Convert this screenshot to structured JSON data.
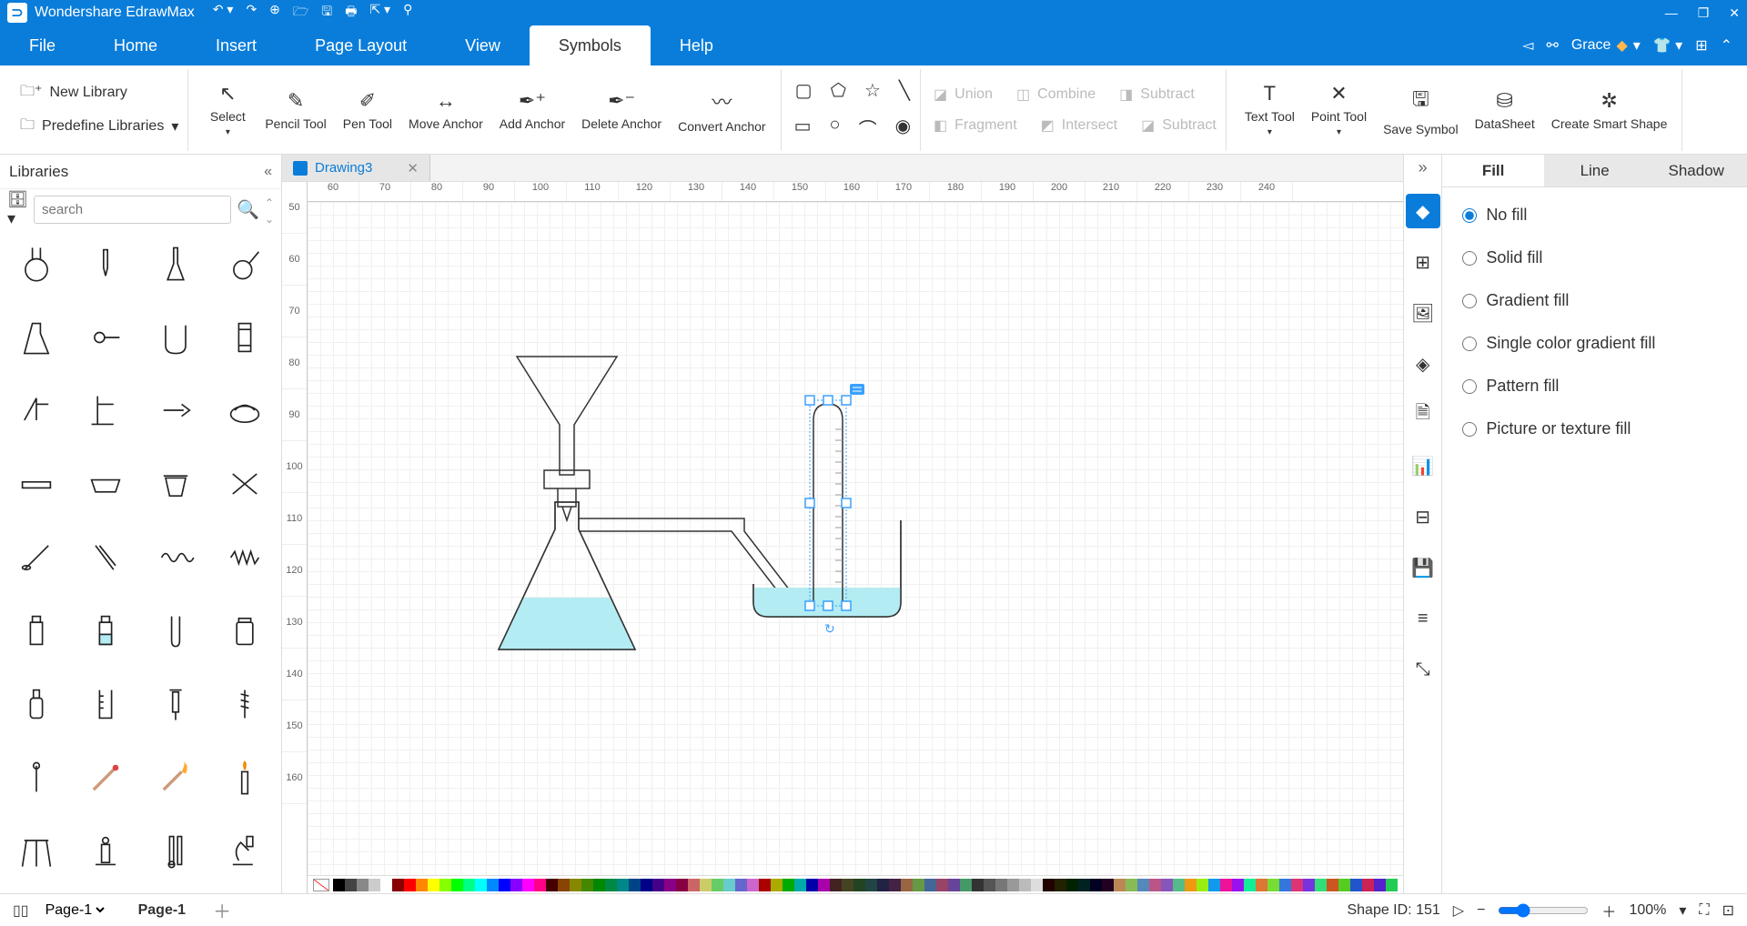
{
  "app": {
    "title": "Wondershare EdrawMax"
  },
  "menu": {
    "items": [
      "File",
      "Home",
      "Insert",
      "Page Layout",
      "View",
      "Symbols",
      "Help"
    ],
    "active": "Symbols",
    "user": "Grace"
  },
  "ribbon": {
    "new_library": "New Library",
    "predef_libs": "Predefine Libraries",
    "select": "Select",
    "pencil": "Pencil Tool",
    "pen": "Pen Tool",
    "move_anchor": "Move Anchor",
    "add_anchor": "Add Anchor",
    "delete_anchor": "Delete Anchor",
    "convert_anchor": "Convert Anchor",
    "bool": {
      "union": "Union",
      "combine": "Combine",
      "subtract": "Subtract",
      "fragment": "Fragment",
      "intersect": "Intersect",
      "subtract2": "Subtract"
    },
    "text_tool": "Text Tool",
    "point_tool": "Point Tool",
    "save_symbol": "Save Symbol",
    "datasheet": "DataSheet",
    "create_smart": "Create Smart Shape"
  },
  "left": {
    "header": "Libraries",
    "search_placeholder": "search"
  },
  "tab": {
    "name": "Drawing3"
  },
  "ruler_h": [
    "60",
    "70",
    "80",
    "90",
    "100",
    "110",
    "120",
    "130",
    "140",
    "150",
    "160",
    "170",
    "180",
    "190",
    "200",
    "210",
    "220",
    "230",
    "240"
  ],
  "ruler_v": [
    "50",
    "60",
    "70",
    "80",
    "90",
    "100",
    "110",
    "120",
    "130",
    "140",
    "150",
    "160"
  ],
  "right": {
    "tabs": [
      "Fill",
      "Line",
      "Shadow"
    ],
    "active": "Fill",
    "options": [
      "No fill",
      "Solid fill",
      "Gradient fill",
      "Single color gradient fill",
      "Pattern fill",
      "Picture or texture fill"
    ],
    "selected": "No fill"
  },
  "status": {
    "page_sel": "Page-1",
    "page_name": "Page-1",
    "shape_id": "Shape ID: 151",
    "zoom": "100%"
  },
  "colors": [
    "#000",
    "#444",
    "#888",
    "#ccc",
    "#fff",
    "#800",
    "#f00",
    "#f80",
    "#ff0",
    "#8f0",
    "#0f0",
    "#0f8",
    "#0ff",
    "#08f",
    "#00f",
    "#80f",
    "#f0f",
    "#f08",
    "#400",
    "#840",
    "#880",
    "#480",
    "#080",
    "#084",
    "#088",
    "#048",
    "#008",
    "#408",
    "#808",
    "#804",
    "#c66",
    "#cc6",
    "#6c6",
    "#6cc",
    "#66c",
    "#c6c",
    "#a00",
    "#aa0",
    "#0a0",
    "#0aa",
    "#00a",
    "#a0a",
    "#422",
    "#442",
    "#242",
    "#244",
    "#224",
    "#424",
    "#964",
    "#694",
    "#469",
    "#946",
    "#649",
    "#496",
    "#333",
    "#555",
    "#777",
    "#999",
    "#bbb",
    "#ddd",
    "#200",
    "#220",
    "#020",
    "#022",
    "#002",
    "#202",
    "#b85",
    "#8b5",
    "#58b",
    "#b58",
    "#85b",
    "#5b8",
    "#e91",
    "#9e1",
    "#19e",
    "#e19",
    "#91e",
    "#1e9",
    "#d73",
    "#7d3",
    "#37d",
    "#d37",
    "#73d",
    "#3d7",
    "#c52",
    "#5c2",
    "#25c",
    "#c25",
    "#52c",
    "#2c5"
  ]
}
